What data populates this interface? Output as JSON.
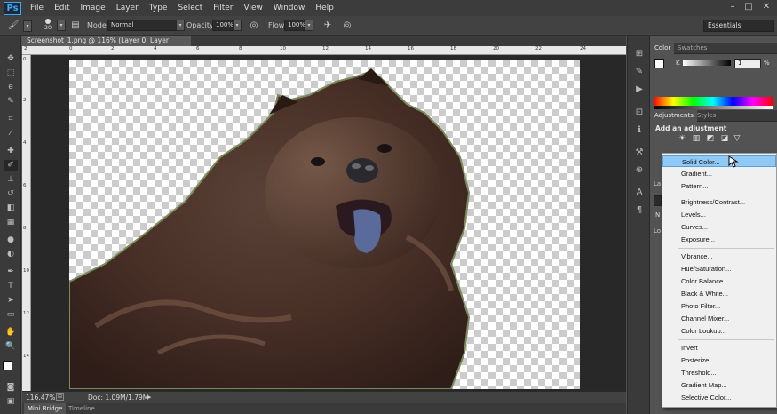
{
  "app": {
    "logo": "Ps",
    "menu": [
      "File",
      "Edit",
      "Image",
      "Layer",
      "Type",
      "Select",
      "Filter",
      "View",
      "Window",
      "Help"
    ],
    "window_controls": [
      "–",
      "□",
      "✕"
    ]
  },
  "options_bar": {
    "brush_size": "20",
    "mode_label": "Mode:",
    "mode_value": "Normal",
    "opacity_label": "Opacity:",
    "opacity_value": "100%",
    "flow_label": "Flow:",
    "flow_value": "100%",
    "workspace": "Essentials"
  },
  "document": {
    "tab_title": "Screenshot_1.png @ 116% (Layer 0, Layer Mask/8) *",
    "tab_close": "×",
    "zoom": "116.47%",
    "doc_info": "Doc: 1.09M/1.79M",
    "ruler_top": [
      "2",
      "0",
      "2",
      "4",
      "6",
      "8",
      "10",
      "12",
      "14",
      "16",
      "18",
      "20",
      "22",
      "24"
    ],
    "ruler_left": [
      "0",
      "2",
      "4",
      "6",
      "8",
      "10",
      "12",
      "14"
    ]
  },
  "bottom_tabs": [
    "Mini Bridge",
    "Timeline"
  ],
  "color_panel": {
    "tabs": [
      "Color",
      "Swatches"
    ],
    "k_label": "K",
    "k_value": "1",
    "unit": "%"
  },
  "adjustments_panel": {
    "tabs": [
      "Adjustments",
      "Styles"
    ],
    "heading": "Add an adjustment"
  },
  "layers_partial": {
    "labels": [
      "La",
      "Lo",
      "N"
    ]
  },
  "dropdown": {
    "groups": [
      [
        "Solid Color...",
        "Gradient...",
        "Pattern..."
      ],
      [
        "Brightness/Contrast...",
        "Levels...",
        "Curves...",
        "Exposure..."
      ],
      [
        "Vibrance...",
        "Hue/Saturation...",
        "Color Balance...",
        "Black & White...",
        "Photo Filter...",
        "Channel Mixer...",
        "Color Lookup..."
      ],
      [
        "Invert",
        "Posterize...",
        "Threshold...",
        "Gradient Map...",
        "Selective Color..."
      ]
    ],
    "highlighted": "Solid Color..."
  },
  "colors": {
    "accent_highlight": "#90c8f6",
    "app_bg": "#535353",
    "menubar_bg": "#3c3c3c",
    "ps_blue": "#3fa9f5"
  },
  "icons": {
    "tools": [
      "move-icon",
      "marquee-icon",
      "lasso-icon",
      "quick-select-icon",
      "crop-icon",
      "eyedropper-icon",
      "healing-icon",
      "brush-icon",
      "stamp-icon",
      "history-brush-icon",
      "eraser-icon",
      "gradient-icon",
      "blur-icon",
      "dodge-icon",
      "pen-icon",
      "type-icon",
      "path-select-icon",
      "shape-icon",
      "hand-icon",
      "zoom-icon"
    ]
  }
}
